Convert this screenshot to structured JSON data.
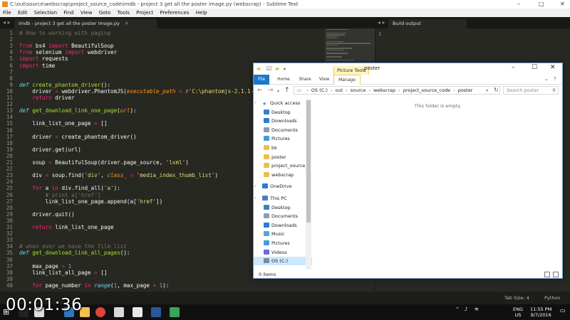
{
  "sublime": {
    "title": "C:\\out\\source\\webscrap\\project_source_code\\imdb - project 3 get all the poster image.py (webscrap) - Sublime Text",
    "window_controls": [
      "–",
      "□",
      "✕"
    ],
    "menu": [
      "File",
      "Edit",
      "Selection",
      "Find",
      "View",
      "Goto",
      "Tools",
      "Project",
      "Preferences",
      "Help"
    ],
    "tab_label": "imdb - project 3 get all the poster image.py",
    "tab_close": "✕",
    "build_tab_label": "Build output",
    "nav_arrows": "◂ ▸",
    "status": {
      "tab_size": "Tab Size: 4",
      "syntax": "Python"
    },
    "build_line_number": "1"
  },
  "code_lines": [
    {
      "n": "1",
      "t": [
        {
          "c": "c",
          "v": "# How to working with paging"
        }
      ]
    },
    {
      "n": "2",
      "t": []
    },
    {
      "n": "3",
      "t": [
        {
          "c": "k",
          "v": "from"
        },
        {
          "v": " bs4 "
        },
        {
          "c": "k",
          "v": "import"
        },
        {
          "v": " BeautifulSoup"
        }
      ]
    },
    {
      "n": "4",
      "t": [
        {
          "c": "k",
          "v": "from"
        },
        {
          "v": " selenium "
        },
        {
          "c": "k",
          "v": "import"
        },
        {
          "v": " webdriver"
        }
      ]
    },
    {
      "n": "5",
      "t": [
        {
          "c": "k",
          "v": "import"
        },
        {
          "v": " requests"
        }
      ]
    },
    {
      "n": "6",
      "t": [
        {
          "c": "k",
          "v": "import"
        },
        {
          "v": " time"
        }
      ]
    },
    {
      "n": "7",
      "t": []
    },
    {
      "n": "8",
      "t": []
    },
    {
      "n": "9",
      "t": [
        {
          "c": "d",
          "v": "def"
        },
        {
          "v": " "
        },
        {
          "c": "f",
          "v": "create_phantom_driver"
        },
        {
          "v": "():"
        }
      ]
    },
    {
      "n": "10",
      "t": [
        {
          "v": "    driver "
        },
        {
          "c": "k",
          "v": "="
        },
        {
          "v": " webdriver.PhantomJS("
        },
        {
          "c": "p",
          "v": "executable_path"
        },
        {
          "v": " "
        },
        {
          "c": "k",
          "v": "="
        },
        {
          "v": " "
        },
        {
          "c": "s",
          "v": "r'C:\\phantomjs-2.1.1-windo"
        }
      ]
    },
    {
      "n": "11",
      "t": [
        {
          "v": "    "
        },
        {
          "c": "k",
          "v": "return"
        },
        {
          "v": " driver"
        }
      ]
    },
    {
      "n": "12",
      "t": []
    },
    {
      "n": "13",
      "t": [
        {
          "c": "d",
          "v": "def"
        },
        {
          "v": " "
        },
        {
          "c": "f",
          "v": "get_download_link_one_page"
        },
        {
          "v": "("
        },
        {
          "c": "p",
          "v": "url"
        },
        {
          "v": "):"
        }
      ]
    },
    {
      "n": "14",
      "t": []
    },
    {
      "n": "15",
      "t": [
        {
          "v": "    link_list_one_page "
        },
        {
          "c": "k",
          "v": "="
        },
        {
          "v": " []"
        }
      ]
    },
    {
      "n": "16",
      "t": []
    },
    {
      "n": "17",
      "t": [
        {
          "v": "    driver "
        },
        {
          "c": "k",
          "v": "="
        },
        {
          "v": " create_phantom_driver()"
        }
      ]
    },
    {
      "n": "18",
      "t": []
    },
    {
      "n": "19",
      "t": [
        {
          "v": "    driver.get(url)"
        }
      ]
    },
    {
      "n": "20",
      "t": []
    },
    {
      "n": "21",
      "t": [
        {
          "v": "    soup "
        },
        {
          "c": "k",
          "v": "="
        },
        {
          "v": " BeautifulSoup(driver.page_source, "
        },
        {
          "c": "s",
          "v": "'lxml'"
        },
        {
          "v": ")"
        }
      ]
    },
    {
      "n": "22",
      "t": []
    },
    {
      "n": "23",
      "t": [
        {
          "v": "    div "
        },
        {
          "c": "k",
          "v": "="
        },
        {
          "v": " soup.find("
        },
        {
          "c": "s",
          "v": "'div'"
        },
        {
          "v": ", "
        },
        {
          "c": "p",
          "v": "class_"
        },
        {
          "v": " "
        },
        {
          "c": "k",
          "v": "="
        },
        {
          "v": " "
        },
        {
          "c": "s",
          "v": "'media_index_thumb_list'"
        },
        {
          "v": ")"
        }
      ]
    },
    {
      "n": "24",
      "t": []
    },
    {
      "n": "25",
      "t": [
        {
          "v": "    "
        },
        {
          "c": "k",
          "v": "for"
        },
        {
          "v": " a "
        },
        {
          "c": "k",
          "v": "in"
        },
        {
          "v": " div.find_all("
        },
        {
          "c": "s",
          "v": "'a'"
        },
        {
          "v": "):"
        }
      ]
    },
    {
      "n": "26",
      "t": [
        {
          "v": "        "
        },
        {
          "c": "c",
          "v": "# print a['href']"
        }
      ]
    },
    {
      "n": "27",
      "t": [
        {
          "v": "        link_list_one_page.append(a["
        },
        {
          "c": "s",
          "v": "'href'"
        },
        {
          "v": "])"
        }
      ]
    },
    {
      "n": "28",
      "t": []
    },
    {
      "n": "29",
      "t": [
        {
          "v": "    driver.quit()"
        }
      ]
    },
    {
      "n": "30",
      "t": []
    },
    {
      "n": "31",
      "t": [
        {
          "v": "    "
        },
        {
          "c": "k",
          "v": "return"
        },
        {
          "v": " link_list_one_page"
        }
      ]
    },
    {
      "n": "32",
      "t": []
    },
    {
      "n": "33",
      "t": []
    },
    {
      "n": "34",
      "t": [
        {
          "c": "c",
          "v": "# when ever we have the film list"
        }
      ]
    },
    {
      "n": "35",
      "t": [
        {
          "c": "d",
          "v": "def"
        },
        {
          "v": " "
        },
        {
          "c": "f",
          "v": "get_download_link_all_pages"
        },
        {
          "v": "():"
        }
      ]
    },
    {
      "n": "36",
      "t": []
    },
    {
      "n": "37",
      "t": [
        {
          "v": "    max_page "
        },
        {
          "c": "k",
          "v": "="
        },
        {
          "v": " "
        },
        {
          "c": "n",
          "v": "1"
        }
      ]
    },
    {
      "n": "38",
      "t": [
        {
          "v": "    link_list_all_page "
        },
        {
          "c": "k",
          "v": "="
        },
        {
          "v": " []"
        }
      ]
    },
    {
      "n": "39",
      "t": []
    },
    {
      "n": "40",
      "t": [
        {
          "v": "    "
        },
        {
          "c": "k",
          "v": "for"
        },
        {
          "v": " page_number "
        },
        {
          "c": "k",
          "v": "in"
        },
        {
          "v": " "
        },
        {
          "c": "d",
          "v": "range"
        },
        {
          "v": "("
        },
        {
          "c": "n",
          "v": "1"
        },
        {
          "v": ", max_page "
        },
        {
          "c": "k",
          "v": "+"
        },
        {
          "v": " "
        },
        {
          "c": "n",
          "v": "1"
        },
        {
          "v": "):"
        }
      ]
    }
  ],
  "explorer": {
    "window_title": "poster",
    "context_tab": "Picture Tools",
    "ribbon_tabs": [
      "File",
      "Home",
      "Share",
      "View",
      "Manage"
    ],
    "window_controls": [
      "–",
      "☐",
      "✕"
    ],
    "address_path": [
      "OS (C:)",
      "out",
      "source",
      "webscrap",
      "project_source_code",
      "poster"
    ],
    "search_placeholder": "Search poster",
    "empty_message": "This folder is empty.",
    "status_text": "0 items",
    "nav": [
      {
        "label": "Quick access",
        "type": "star",
        "pin": false,
        "sel": false,
        "indent": 1
      },
      {
        "label": "Desktop",
        "type": "desk",
        "pin": true,
        "sel": false,
        "indent": 2
      },
      {
        "label": "Downloads",
        "type": "down",
        "pin": true,
        "sel": false,
        "indent": 2
      },
      {
        "label": "Documents",
        "type": "doc",
        "pin": true,
        "sel": false,
        "indent": 2
      },
      {
        "label": "Pictures",
        "type": "pic",
        "pin": true,
        "sel": false,
        "indent": 2
      },
      {
        "label": "bk",
        "type": "folder",
        "pin": false,
        "sel": false,
        "indent": 2
      },
      {
        "label": "poster",
        "type": "folder",
        "pin": false,
        "sel": false,
        "indent": 2
      },
      {
        "label": "project_source_c",
        "type": "folder",
        "pin": false,
        "sel": false,
        "indent": 2
      },
      {
        "label": "webscrap",
        "type": "folder",
        "pin": false,
        "sel": false,
        "indent": 2
      },
      {
        "label": "",
        "type": "gap",
        "pin": false,
        "sel": false,
        "indent": 0
      },
      {
        "label": "OneDrive",
        "type": "cloud",
        "pin": false,
        "sel": false,
        "indent": 1
      },
      {
        "label": "",
        "type": "gap",
        "pin": false,
        "sel": false,
        "indent": 0
      },
      {
        "label": "This PC",
        "type": "pc",
        "pin": false,
        "sel": false,
        "indent": 1
      },
      {
        "label": "Desktop",
        "type": "desk",
        "pin": false,
        "sel": false,
        "indent": 2
      },
      {
        "label": "Documents",
        "type": "doc",
        "pin": false,
        "sel": false,
        "indent": 2
      },
      {
        "label": "Downloads",
        "type": "down",
        "pin": false,
        "sel": false,
        "indent": 2
      },
      {
        "label": "Music",
        "type": "music",
        "pin": false,
        "sel": false,
        "indent": 2
      },
      {
        "label": "Pictures",
        "type": "pic",
        "pin": false,
        "sel": false,
        "indent": 2
      },
      {
        "label": "Videos",
        "type": "video",
        "pin": false,
        "sel": false,
        "indent": 2
      },
      {
        "label": "OS (C:)",
        "type": "drive",
        "pin": false,
        "sel": true,
        "indent": 2
      }
    ]
  },
  "timer": "00:01:36",
  "taskbar": {
    "lang": "ENG",
    "region": "US",
    "time": "11:55 PM",
    "date": "9/7/2016",
    "apps": [
      {
        "name": "windows-start-icon",
        "color": "#ffffff"
      },
      {
        "name": "search-icon",
        "color": "#222222"
      },
      {
        "name": "task-view-icon",
        "color": "#dddddd"
      },
      {
        "name": "edge-icon",
        "color": "#3277bc"
      },
      {
        "name": "file-explorer-icon",
        "color": "#f2c14e"
      },
      {
        "name": "chrome-icon",
        "color": "#db4437"
      },
      {
        "name": "store-icon",
        "color": "#d9d9d9"
      },
      {
        "name": "media-player-icon",
        "color": "#e8e8e8"
      },
      {
        "name": "word-icon",
        "color": "#2b5797"
      },
      {
        "name": "camtasia-icon",
        "color": "#3aa655"
      }
    ]
  },
  "colors": {
    "editor_bg": "#272822",
    "keyword": "#f92672",
    "string": "#e6db74",
    "comment": "#75715e",
    "function": "#a6e22e",
    "storage": "#66d9ef",
    "file_tab": "#1979ca",
    "selection": "#cce8ff"
  }
}
